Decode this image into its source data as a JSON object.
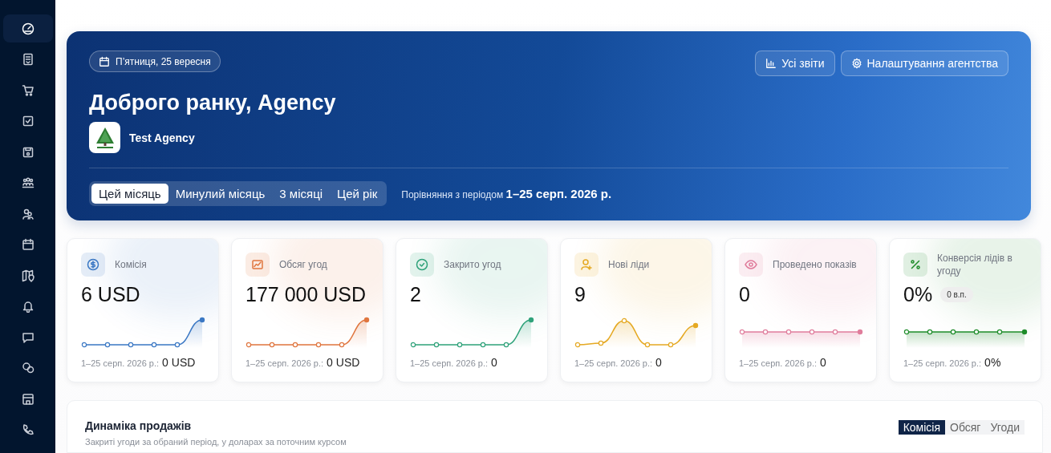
{
  "sidebar": {
    "items": [
      {
        "kind": "gauge",
        "selected": true
      },
      {
        "kind": "document",
        "selected": false
      },
      {
        "kind": "cart",
        "selected": false
      },
      {
        "kind": "checkbox",
        "selected": false
      },
      {
        "kind": "save",
        "selected": false
      },
      {
        "kind": "team",
        "selected": false
      },
      {
        "kind": "users",
        "selected": false
      },
      {
        "kind": "calendar",
        "selected": false
      },
      {
        "kind": "map",
        "selected": false
      },
      {
        "kind": "bell",
        "selected": false
      },
      {
        "kind": "chat",
        "selected": false
      },
      {
        "kind": "chats",
        "selected": false
      },
      {
        "kind": "store",
        "selected": false
      },
      {
        "kind": "phone",
        "selected": false
      }
    ]
  },
  "hero": {
    "date": "П’ятниця, 25 вересня",
    "buttons": [
      {
        "kind": "chart",
        "label": "Усі звіти"
      },
      {
        "kind": "gear",
        "label": "Налаштування агентства"
      }
    ],
    "greeting": "Доброго ранку, Agency",
    "agency": "Test Agency",
    "periods": [
      {
        "label": "Цей місяць",
        "selected": true
      },
      {
        "label": "Минулий місяць",
        "selected": false
      },
      {
        "label": "3 місяці",
        "selected": false
      },
      {
        "label": "Цей рік",
        "selected": false
      }
    ],
    "comparison_label": "Порівняння з періодом",
    "comparison_period": "1–25 серп. 2026 р."
  },
  "stats": [
    {
      "kind": "dollar",
      "color": "#3b78c4",
      "title": "Комісія",
      "value": "6 USD",
      "sparkline": {
        "kind": "rise"
      },
      "compare_label": "1–25 серп. 2026 р.:",
      "compare_value": "0 USD"
    },
    {
      "kind": "linechart",
      "color": "#e0763f",
      "title": "Обсяг угод",
      "value": "177 000 USD",
      "sparkline": {
        "kind": "rise"
      },
      "compare_label": "1–25 серп. 2026 р.:",
      "compare_value": "0 USD"
    },
    {
      "kind": "check",
      "color": "#2fa27a",
      "title": "Закрито угод",
      "value": "2",
      "sparkline": {
        "kind": "rise"
      },
      "compare_label": "1–25 серп. 2026 р.:",
      "compare_value": "0"
    },
    {
      "kind": "user",
      "color": "#e5a923",
      "title": "Нові ліди",
      "value": "9",
      "sparkline": {
        "kind": "bump"
      },
      "compare_label": "1–25 серп. 2026 р.:",
      "compare_value": "0"
    },
    {
      "kind": "eye",
      "color": "#e07d9c",
      "title": "Проведено показів",
      "value": "0",
      "sparkline": {
        "kind": "flat"
      },
      "compare_label": "1–25 серп. 2026 р.:",
      "compare_value": "0"
    },
    {
      "kind": "percent",
      "color": "#1e8c2a",
      "title": "Конверсія лідів в угоду",
      "value": "0%",
      "badge": "0 в.п.",
      "sparkline": {
        "kind": "flat"
      },
      "compare_label": "1–25 серп. 2026 р.:",
      "compare_value": "0%"
    }
  ],
  "sales": {
    "title": "Динаміка продажів",
    "subtitle": "Закриті угоди за обраний період, у доларах за поточним курсом",
    "tabs": [
      {
        "label": "Комісія",
        "selected": true
      },
      {
        "label": "Обсяг",
        "selected": false
      },
      {
        "label": "Угоди",
        "selected": false
      }
    ]
  }
}
